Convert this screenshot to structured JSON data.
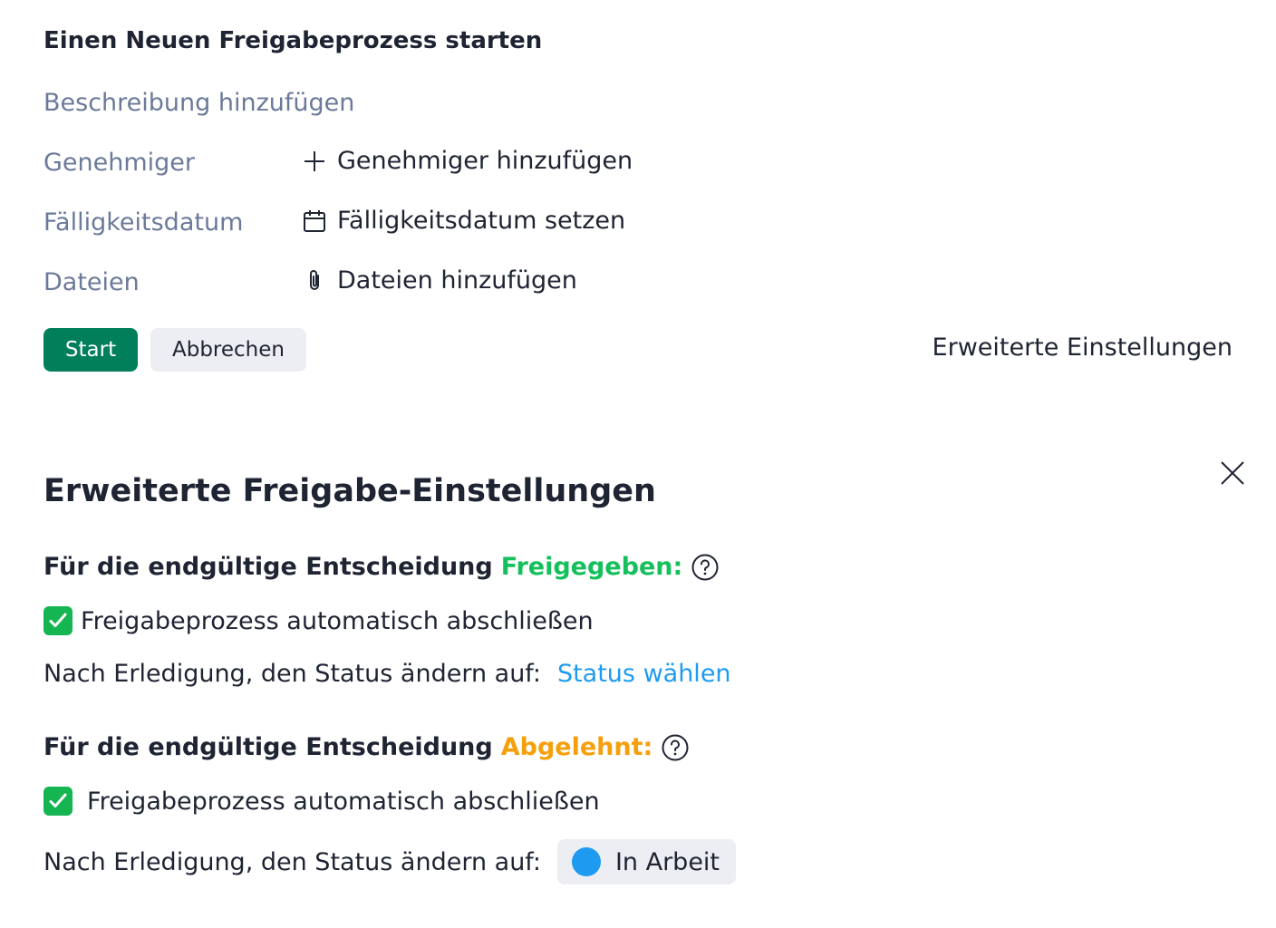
{
  "form": {
    "title": "Einen Neuen Freigabeprozess starten",
    "description_placeholder": "Beschreibung hinzufügen",
    "fields": [
      {
        "label": "Genehmiger",
        "action": "Genehmiger hinzufügen",
        "icon": "plus-icon"
      },
      {
        "label": "Fälligkeitsdatum",
        "action": "Fälligkeitsdatum setzen",
        "icon": "calendar-icon"
      },
      {
        "label": "Dateien",
        "action": "Dateien hinzufügen",
        "icon": "paperclip-icon"
      }
    ],
    "start_label": "Start",
    "cancel_label": "Abbrechen",
    "advanced_link": "Erweiterte Einstellungen"
  },
  "advanced": {
    "title": "Erweiterte Freigabe-Einstellungen",
    "approved": {
      "heading_prefix": "Für die endgültige Entscheidung",
      "heading_accent": "Freigegeben:",
      "accent_color": "#15c05c",
      "checkbox_label": "Freigabeprozess automatisch abschließen",
      "checked": true,
      "status_label": "Nach Erledigung, den Status ändern auf:",
      "status_value": "Status wählen"
    },
    "rejected": {
      "heading_prefix": "Für die endgültige Entscheidung",
      "heading_accent": "Abgelehnt:",
      "accent_color": "#f59f0a",
      "checkbox_label": "Freigabeprozess automatisch abschließen",
      "checked": true,
      "status_label": "Nach Erledigung, den Status ändern auf:",
      "status_value": "In Arbeit",
      "status_color": "#1e9bf0"
    }
  },
  "colors": {
    "primary": "#017f5b",
    "link": "#1e9bf0",
    "checkbox": "#15b552"
  }
}
